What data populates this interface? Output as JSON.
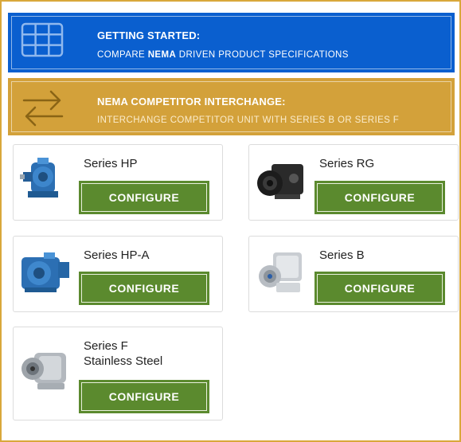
{
  "colors": {
    "blue_banner": "#0a5fcf",
    "gold_banner": "#d3a13a",
    "configure_button": "#5b8a2e",
    "frame_border": "#d9a83a"
  },
  "getting_started": {
    "icon": "grid-icon",
    "title": "GETTING STARTED:",
    "sub_prefix": "COMPARE ",
    "sub_emphasis": "NEMA",
    "sub_suffix": " DRIVEN PRODUCT SPECIFICATIONS"
  },
  "interchange": {
    "icon": "swap-arrows-icon",
    "title": "NEMA COMPETITOR INTERCHANGE:",
    "sub": "INTERCHANGE COMPETITOR UNIT WITH SERIES B OR SERIES F"
  },
  "products": [
    {
      "name": "Series HP",
      "button": "CONFIGURE",
      "image": "blue-worm-gearbox-image"
    },
    {
      "name": "Series RG",
      "button": "CONFIGURE",
      "image": "black-gearbox-image"
    },
    {
      "name": "Series HP-A",
      "button": "CONFIGURE",
      "image": "blue-gearbox-image"
    },
    {
      "name": "Series B",
      "button": "CONFIGURE",
      "image": "silver-bevel-gearbox-image"
    },
    {
      "name_line1": "Series F",
      "name_line2": "Stainless Steel",
      "button": "CONFIGURE",
      "image": "stainless-gearbox-image"
    }
  ]
}
